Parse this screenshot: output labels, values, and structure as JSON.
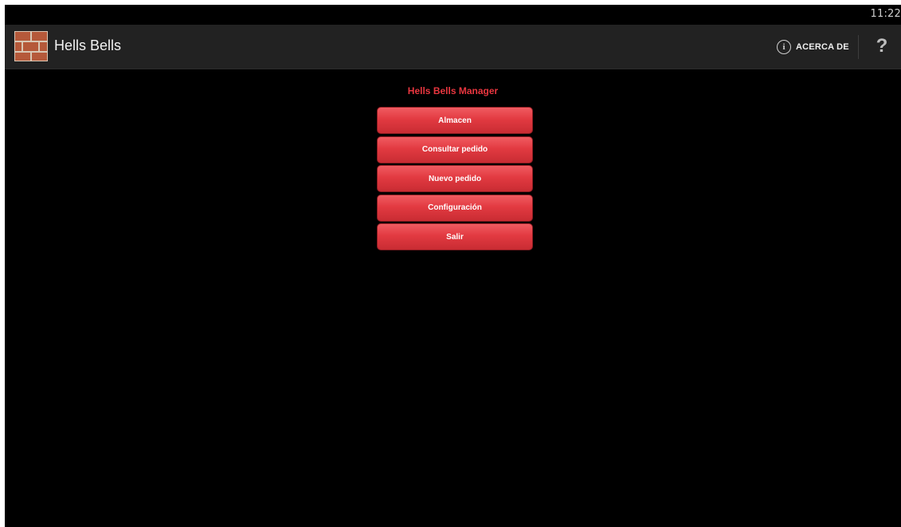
{
  "status_bar": {
    "time": "11:22"
  },
  "action_bar": {
    "logo_icon": "brick-wall-icon",
    "title": "Hells Bells",
    "about": {
      "icon": "info-icon",
      "label": "ACERCA DE"
    },
    "help": {
      "icon": "help-icon",
      "glyph": "?"
    }
  },
  "main": {
    "title": "Hells Bells Manager",
    "buttons": [
      {
        "label": "Almacen"
      },
      {
        "label": "Consultar pedido"
      },
      {
        "label": "Nuevo pedido"
      },
      {
        "label": "Configuración"
      },
      {
        "label": "Salir"
      }
    ]
  },
  "colors": {
    "accent": "#e8363f",
    "button_top": "#f05b61",
    "button_bottom": "#c92c33",
    "action_bar": "#222222",
    "background": "#000000",
    "logo_brick": "#b5593a"
  }
}
